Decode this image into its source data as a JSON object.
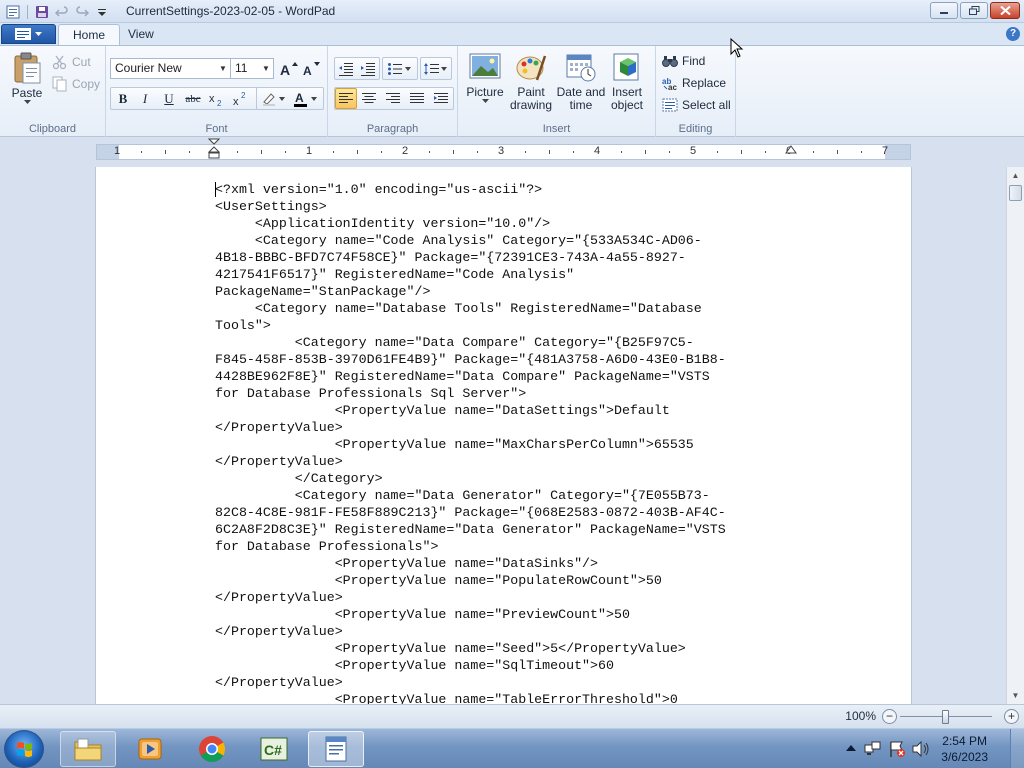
{
  "window": {
    "title": "CurrentSettings-2023-02-05 - WordPad"
  },
  "tabs": {
    "home": "Home",
    "view": "View"
  },
  "ribbon": {
    "clipboard": {
      "label": "Clipboard",
      "paste": "Paste",
      "cut": "Cut",
      "copy": "Copy"
    },
    "font": {
      "label": "Font",
      "family": "Courier New",
      "size": "11"
    },
    "paragraph": {
      "label": "Paragraph"
    },
    "insert": {
      "label": "Insert",
      "picture": "Picture",
      "paint_1": "Paint",
      "paint_2": "drawing",
      "datetime_1": "Date and",
      "datetime_2": "time",
      "object_1": "Insert",
      "object_2": "object"
    },
    "editing": {
      "label": "Editing",
      "find": "Find",
      "replace": "Replace",
      "select_all": "Select all"
    }
  },
  "ruler": {
    "numbers": [
      "1",
      "1",
      "2",
      "3",
      "4",
      "5",
      "6",
      "7"
    ]
  },
  "document": {
    "lines": [
      "<?xml version=\"1.0\" encoding=\"us-ascii\"?>",
      "<UserSettings>",
      "     <ApplicationIdentity version=\"10.0\"/>",
      "     <Category name=\"Code Analysis\" Category=\"{533A534C-AD06-",
      "4B18-BBBC-BFD7C74F58CE}\" Package=\"{72391CE3-743A-4a55-8927-",
      "4217541F6517}\" RegisteredName=\"Code Analysis\"",
      "PackageName=\"StanPackage\"/>",
      "     <Category name=\"Database Tools\" RegisteredName=\"Database",
      "Tools\">",
      "          <Category name=\"Data Compare\" Category=\"{B25F97C5-",
      "F845-458F-853B-3970D61FE4B9}\" Package=\"{481A3758-A6D0-43E0-B1B8-",
      "4428BE962F8E}\" RegisteredName=\"Data Compare\" PackageName=\"VSTS",
      "for Database Professionals Sql Server\">",
      "               <PropertyValue name=\"DataSettings\">Default",
      "</PropertyValue>",
      "               <PropertyValue name=\"MaxCharsPerColumn\">65535",
      "</PropertyValue>",
      "          </Category>",
      "          <Category name=\"Data Generator\" Category=\"{7E055B73-",
      "82C8-4C8E-981F-FE58F889C213}\" Package=\"{068E2583-0872-403B-AF4C-",
      "6C2A8F2D8C3E}\" RegisteredName=\"Data Generator\" PackageName=\"VSTS",
      "for Database Professionals\">",
      "               <PropertyValue name=\"DataSinks\"/>",
      "               <PropertyValue name=\"PopulateRowCount\">50",
      "</PropertyValue>",
      "               <PropertyValue name=\"PreviewCount\">50",
      "</PropertyValue>",
      "               <PropertyValue name=\"Seed\">5</PropertyValue>",
      "               <PropertyValue name=\"SqlTimeout\">60",
      "</PropertyValue>",
      "               <PropertyValue name=\"TableErrorThreshold\">0"
    ]
  },
  "status": {
    "zoom": "100%",
    "zoom_level": 0.5
  },
  "taskbar": {
    "time": "2:54 PM",
    "date": "3/6/2023"
  }
}
